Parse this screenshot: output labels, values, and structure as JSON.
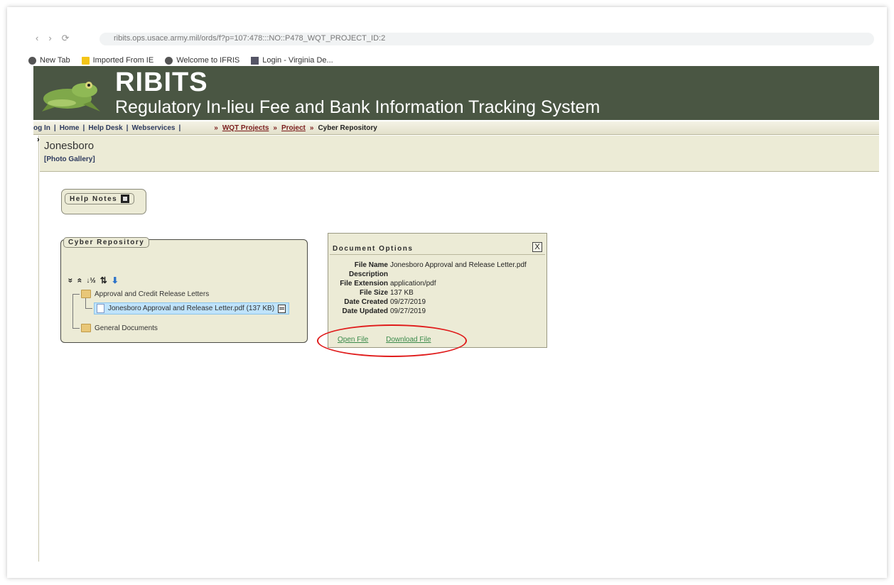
{
  "browser": {
    "url": "ribits.ops.usace.army.mil/ords/f?p=107:478:::NO::P478_WQT_PROJECT_ID:2",
    "bookmarks": [
      {
        "label": "New Tab",
        "icon": "globe-icon"
      },
      {
        "label": "Imported From IE",
        "icon": "folder-icon"
      },
      {
        "label": "Welcome to IFRIS",
        "icon": "globe-icon"
      },
      {
        "label": "Login - Virginia De...",
        "icon": "login-icon"
      }
    ]
  },
  "header": {
    "title": "RIBITS",
    "subtitle": "Regulatory In-lieu Fee and Bank Information Tracking System"
  },
  "nav": {
    "links": [
      "og In",
      "Home",
      "Help Desk",
      "Webservices"
    ],
    "separator": "|",
    "crumb_arrow": "»",
    "breadcrumbs": [
      "WQT Projects",
      "Project"
    ],
    "current": "Cyber Repository"
  },
  "project": {
    "name": "Jonesboro",
    "gallery_link": "[Photo Gallery]"
  },
  "help_notes": {
    "label": "Help Notes"
  },
  "repository": {
    "label": "Cyber Repository",
    "toolbar": [
      "»",
      "«",
      "↓½",
      "⇅",
      "⬇"
    ],
    "folders": [
      {
        "label": "Approval and Credit Release Letters",
        "files": [
          {
            "label": "Jonesboro Approval and Release Letter.pdf (137 KB)"
          }
        ]
      },
      {
        "label": "General Documents",
        "files": []
      }
    ]
  },
  "document_options": {
    "title": "Document Options",
    "close": "X",
    "fields": [
      {
        "label": "File Name",
        "value": "Jonesboro Approval and Release Letter.pdf"
      },
      {
        "label": "Description",
        "value": ""
      },
      {
        "label": "File Extension",
        "value": "application/pdf"
      },
      {
        "label": "File Size",
        "value": "137 KB"
      },
      {
        "label": "Date Created",
        "value": "09/27/2019"
      },
      {
        "label": "Date Updated",
        "value": "09/27/2019"
      }
    ],
    "open_link": "Open File",
    "download_link": "Download File"
  },
  "colors": {
    "header_bg": "#4a5643",
    "panel_bg": "#ecebd6",
    "link_red": "#7a1c1c",
    "annotation": "#e01b1b"
  }
}
